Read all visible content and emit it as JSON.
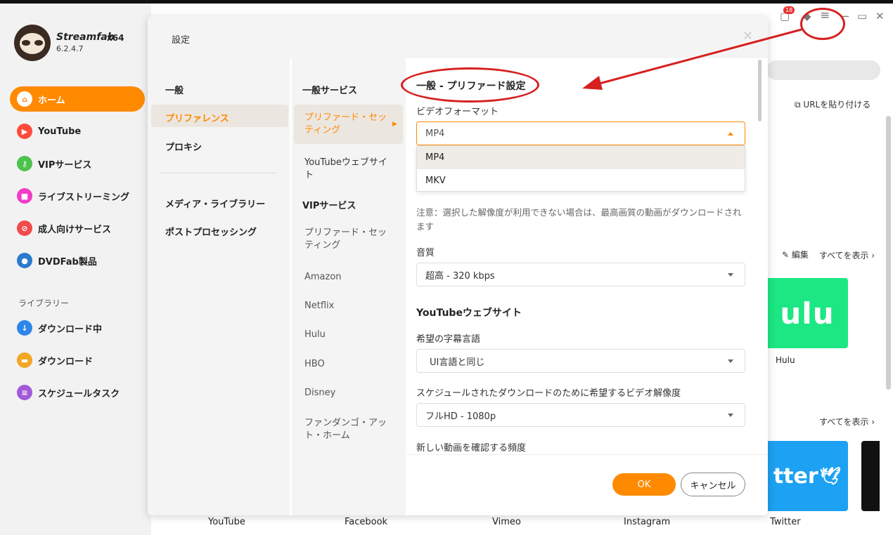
{
  "app": {
    "brand": "Streamfab",
    "arch": "x64",
    "version": "6.2.4.7",
    "notification_count": "18",
    "accent_color": "#ff8a00"
  },
  "sidebar": {
    "items": [
      {
        "label": "ホーム",
        "icon": "home-icon",
        "active": true
      },
      {
        "label": "YouTube",
        "icon": "youtube-icon"
      },
      {
        "label": "VIPサービス",
        "icon": "key-icon"
      },
      {
        "label": "ライブストリーミング",
        "icon": "video-camera-icon"
      },
      {
        "label": "成人向けサービス",
        "icon": "adult-block-icon"
      },
      {
        "label": "DVDFab製品",
        "icon": "dvdfab-icon"
      }
    ],
    "library_heading": "ライブラリー",
    "library_items": [
      {
        "label": "ダウンロード中",
        "icon": "download-arrow-icon"
      },
      {
        "label": "ダウンロード",
        "icon": "folder-icon"
      },
      {
        "label": "スケジュールタスク",
        "icon": "schedule-list-icon"
      }
    ]
  },
  "background": {
    "paste_url": "URLを貼り付ける",
    "edit": "編集",
    "show_all": "すべてを表示",
    "hulu_tile": "ulu",
    "hulu_label": "Hulu",
    "twitter_tile": "tter",
    "bottom_labels": [
      "YouTube",
      "Facebook",
      "Vimeo",
      "Instagram",
      "Twitter"
    ]
  },
  "dialog": {
    "title": "設定",
    "col1": {
      "items": [
        "一般",
        "プリファレンス",
        "プロキシ"
      ],
      "items2": [
        "メディア・ライブラリー",
        "ポストプロセッシング"
      ]
    },
    "col2": {
      "general_heading": "一般サービス",
      "general_items": [
        "プリファード・セッティング",
        "YouTubeウェブサイト"
      ],
      "vip_heading": "VIPサービス",
      "vip_items": [
        "プリファード・セッティング",
        "Amazon",
        "Netflix",
        "Hulu",
        "HBO",
        "Disney",
        "ファンダンゴ・アット・ホーム"
      ]
    },
    "content": {
      "section_title": "一般 - プリファード設定",
      "video_format_label": "ビデオフォーマット",
      "video_format_value": "MP4",
      "format_options": [
        "MP4",
        "MKV"
      ],
      "note": "注意：選択した解像度が利用できない場合は、最高画質の動画がダウンロードされます",
      "audio_label": "音質",
      "audio_value": "超高 - 320 kbps",
      "youtube_title": "YouTubeウェブサイト",
      "subtitle_label": "希望の字幕言語",
      "subtitle_value": "UI言語と同じ",
      "schedule_label": "スケジュールされたダウンロードのために希望するビデオ解像度",
      "schedule_value": "フルHD - 1080p",
      "check_label": "新しい動画を確認する頻度"
    },
    "ok": "OK",
    "cancel": "キャンセル"
  }
}
